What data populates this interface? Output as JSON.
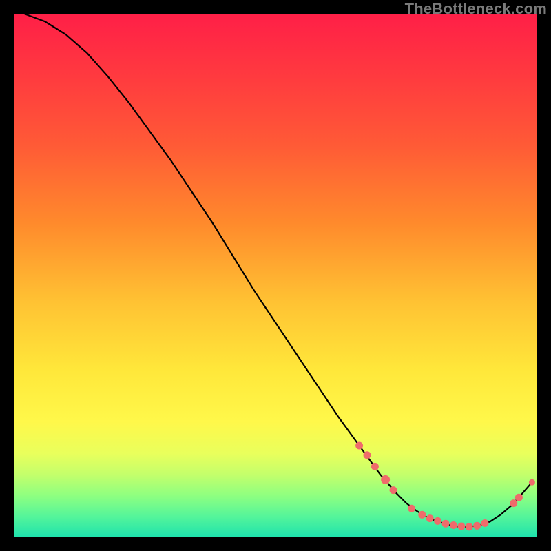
{
  "watermark": "TheBottleneck.com",
  "colors": {
    "curve_stroke": "#000000",
    "marker_fill": "#ef6b6b",
    "marker_stroke": "#ef6b6b"
  },
  "chart_data": {
    "type": "line",
    "title": "",
    "xlabel": "",
    "ylabel": "",
    "xlim": [
      0,
      100
    ],
    "ylim": [
      0,
      100
    ],
    "grid": false,
    "legend": false,
    "series": [
      {
        "name": "curve",
        "x": [
          2,
          6,
          10,
          14,
          18,
          22,
          26,
          30,
          34,
          38,
          42,
          46,
          50,
          54,
          58,
          62,
          66,
          70,
          73,
          75,
          77,
          79,
          81,
          83,
          85,
          87,
          89,
          91,
          93,
          95,
          97,
          99
        ],
        "y": [
          100,
          98.5,
          96,
          92.5,
          88,
          83,
          77.5,
          72,
          66,
          60,
          53.5,
          47,
          41,
          35,
          29,
          23,
          17.5,
          12,
          8.5,
          6.5,
          5,
          3.8,
          3,
          2.4,
          2,
          2,
          2.3,
          3,
          4.3,
          6,
          8.2,
          10.5
        ]
      }
    ],
    "markers": [
      {
        "x": 66,
        "y": 17.5,
        "r": 5
      },
      {
        "x": 67.5,
        "y": 15.7,
        "r": 5
      },
      {
        "x": 69,
        "y": 13.5,
        "r": 5
      },
      {
        "x": 71,
        "y": 11,
        "r": 6
      },
      {
        "x": 72.5,
        "y": 9,
        "r": 5
      },
      {
        "x": 76,
        "y": 5.5,
        "r": 5
      },
      {
        "x": 78,
        "y": 4.3,
        "r": 5
      },
      {
        "x": 79.5,
        "y": 3.6,
        "r": 5
      },
      {
        "x": 81,
        "y": 3.1,
        "r": 5
      },
      {
        "x": 82.5,
        "y": 2.6,
        "r": 5
      },
      {
        "x": 84,
        "y": 2.3,
        "r": 5
      },
      {
        "x": 85.5,
        "y": 2.1,
        "r": 5
      },
      {
        "x": 87,
        "y": 2.0,
        "r": 5
      },
      {
        "x": 88.5,
        "y": 2.2,
        "r": 5
      },
      {
        "x": 90,
        "y": 2.7,
        "r": 5
      },
      {
        "x": 95.5,
        "y": 6.5,
        "r": 5
      },
      {
        "x": 96.5,
        "y": 7.6,
        "r": 5
      },
      {
        "x": 99,
        "y": 10.5,
        "r": 4
      }
    ]
  }
}
